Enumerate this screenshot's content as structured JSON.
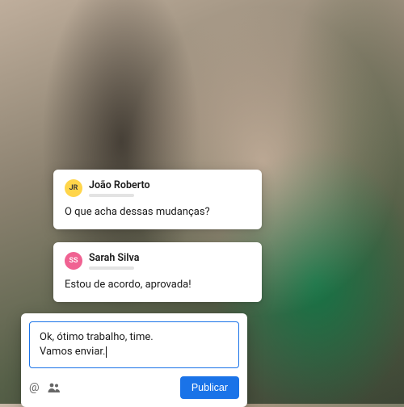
{
  "comments": [
    {
      "initials": "JR",
      "name": "João Roberto",
      "text": "O que acha dessas mudanças?"
    },
    {
      "initials": "SS",
      "name": "Sarah Silva",
      "text": "Estou de acordo, aprovada!"
    }
  ],
  "compose": {
    "value": "Ok, ótimo trabalho, time.\nVamos enviar.",
    "publish_label": "Publicar"
  },
  "icons": {
    "mention": "@",
    "people": "people"
  },
  "colors": {
    "accent": "#1a73e8",
    "avatar_jr": "#ffd54a",
    "avatar_ss": "#f06292"
  }
}
